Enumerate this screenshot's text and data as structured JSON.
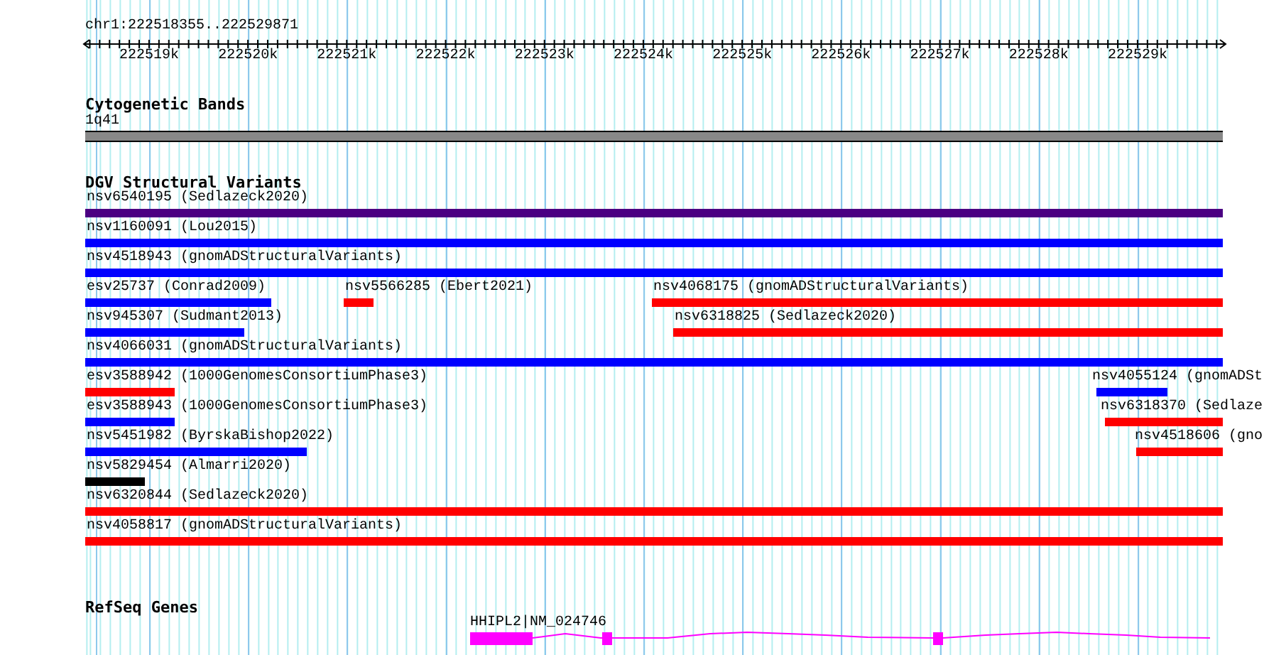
{
  "position": "chr1:222518355..222529871",
  "ruler": {
    "ticks": [
      "222519k",
      "222520k",
      "222521k",
      "222522k",
      "222523k",
      "222524k",
      "222525k",
      "222526k",
      "222527k",
      "222528k",
      "222529k"
    ]
  },
  "tracks": [
    {
      "kind": "cytoband",
      "title": "Cytogenetic Bands",
      "band": "1q41"
    },
    {
      "kind": "variants",
      "title": "DGV Structural Variants",
      "rows": [
        {
          "features": [
            {
              "label": "nsv6540195 (Sedlazeck2020)",
              "color": "#4b0082"
            }
          ]
        },
        {
          "features": [
            {
              "label": "nsv1160091 (Lou2015)",
              "color": "#0000ff"
            }
          ]
        },
        {
          "features": [
            {
              "label": "nsv4518943 (gnomADStructuralVariants)",
              "color": "#0000ff"
            }
          ]
        },
        {
          "features": [
            {
              "label": "esv25737 (Conrad2009)",
              "color": "#0000ff"
            },
            {
              "label": "nsv5566285 (Ebert2021)",
              "color": "#ff0000"
            },
            {
              "label": "nsv4068175 (gnomADStructuralVariants)",
              "color": "#ff0000"
            }
          ]
        },
        {
          "features": [
            {
              "label": "nsv945307 (Sudmant2013)",
              "color": "#0000ff"
            },
            {
              "label": "nsv6318825 (Sedlazeck2020)",
              "color": "#ff0000"
            }
          ]
        },
        {
          "features": [
            {
              "label": "nsv4066031 (gnomADStructuralVariants)",
              "color": "#0000ff"
            }
          ]
        },
        {
          "features": [
            {
              "label": "esv3588942 (1000GenomesConsortiumPhase3)",
              "color": "#ff0000"
            },
            {
              "label": "nsv4055124 (gnomADSt",
              "color": "#0000ff"
            }
          ]
        },
        {
          "features": [
            {
              "label": "esv3588943 (1000GenomesConsortiumPhase3)",
              "color": "#0000ff"
            },
            {
              "label": "nsv6318370 (Sedlaze",
              "color": "#ff0000"
            }
          ]
        },
        {
          "features": [
            {
              "label": "nsv5451982 (ByrskaBishop2022)",
              "color": "#0000ff"
            },
            {
              "label": "nsv4518606 (gno",
              "color": "#ff0000"
            }
          ]
        },
        {
          "features": [
            {
              "label": "nsv5829454 (Almarri2020)",
              "color": "#000000"
            }
          ]
        },
        {
          "features": [
            {
              "label": "nsv6320844 (Sedlazeck2020)",
              "color": "#ff0000"
            }
          ]
        },
        {
          "features": [
            {
              "label": "nsv4058817 (gnomADStructuralVariants)",
              "color": "#ff0000"
            }
          ]
        }
      ]
    },
    {
      "kind": "genes",
      "title": "RefSeq Genes",
      "gene": "HHIPL2|NM_024746"
    }
  ]
}
